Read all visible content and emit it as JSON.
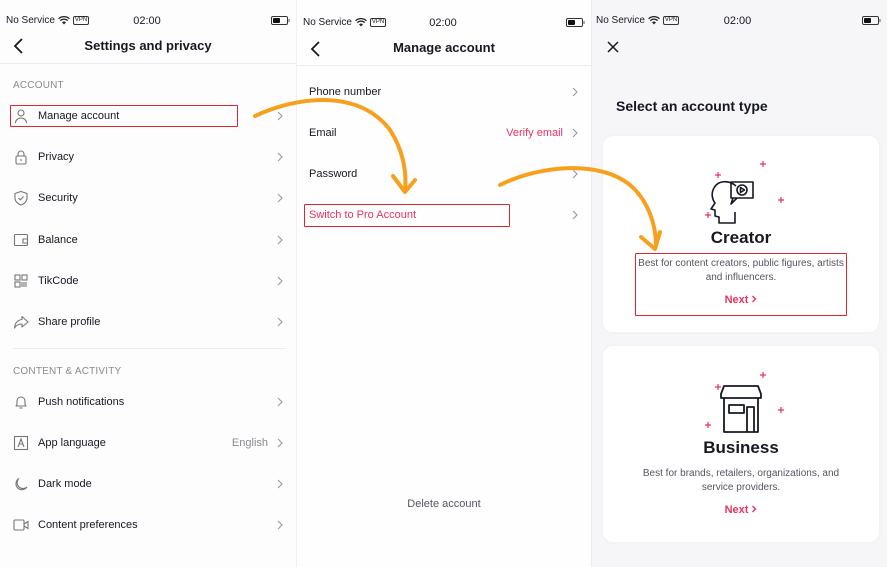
{
  "status_bar": {
    "carrier": "No Service",
    "vpn": "VPN",
    "time": "02:00"
  },
  "settings_screen": {
    "title": "Settings and privacy",
    "sections": [
      {
        "label": "ACCOUNT",
        "items": [
          {
            "label": "Manage account",
            "icon": "person-icon"
          },
          {
            "label": "Privacy",
            "icon": "lock-icon"
          },
          {
            "label": "Security",
            "icon": "shield-icon"
          },
          {
            "label": "Balance",
            "icon": "wallet-icon"
          },
          {
            "label": "TikCode",
            "icon": "qr-code-icon"
          },
          {
            "label": "Share profile",
            "icon": "share-icon"
          }
        ]
      },
      {
        "label": "CONTENT & ACTIVITY",
        "items": [
          {
            "label": "Push notifications",
            "icon": "bell-icon"
          },
          {
            "label": "App language",
            "icon": "language-icon",
            "value": "English"
          },
          {
            "label": "Dark mode",
            "icon": "moon-icon"
          },
          {
            "label": "Content preferences",
            "icon": "video-icon"
          }
        ]
      }
    ]
  },
  "manage_account_screen": {
    "title": "Manage account",
    "items": [
      {
        "label": "Phone number"
      },
      {
        "label": "Email",
        "value": "Verify email"
      },
      {
        "label": "Password"
      },
      {
        "label": "Switch to Pro Account"
      }
    ],
    "delete_label": "Delete account"
  },
  "account_type_screen": {
    "title": "Select an account type",
    "cards": [
      {
        "name": "Creator",
        "description": "Best for content creators, public figures, artists and influencers.",
        "next_label": "Next"
      },
      {
        "name": "Business",
        "description": "Best for brands, retailers, organizations, and service providers.",
        "next_label": "Next"
      }
    ]
  },
  "colors": {
    "accent_pink": "#e8335d",
    "highlight_red": "#e0262d",
    "arrow_orange": "#f7a01d"
  }
}
